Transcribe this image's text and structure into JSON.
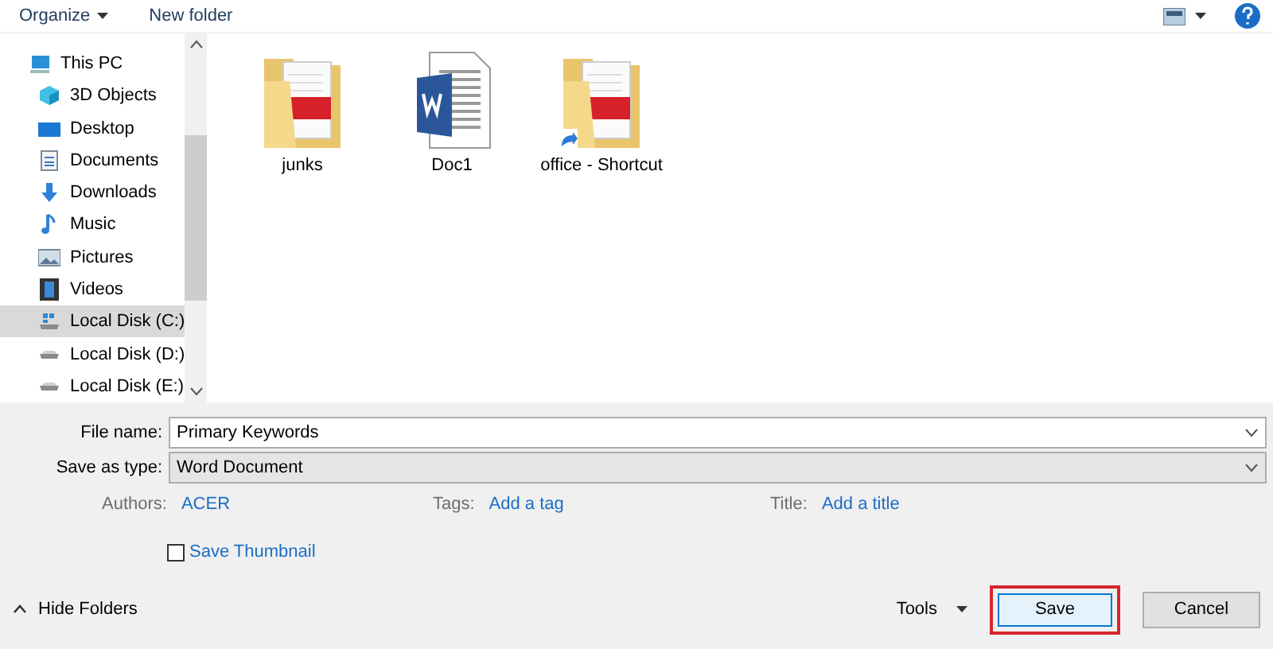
{
  "toolbar": {
    "buttons": [
      {
        "label": "Organize",
        "dropdown": true
      },
      {
        "label": "New folder",
        "dropdown": false
      }
    ]
  },
  "sidebar": {
    "items": [
      {
        "label": "This PC",
        "kind": "pc",
        "selected": false,
        "children": [
          {
            "label": "3D Objects",
            "kind": "cube",
            "selected": false
          },
          {
            "label": "Desktop",
            "kind": "desktop",
            "selected": false
          },
          {
            "label": "Documents",
            "kind": "documents",
            "selected": false
          },
          {
            "label": "Downloads",
            "kind": "downloads",
            "selected": false
          },
          {
            "label": "Music",
            "kind": "music",
            "selected": false
          },
          {
            "label": "Pictures",
            "kind": "pictures",
            "selected": false
          },
          {
            "label": "Videos",
            "kind": "videos",
            "selected": false
          },
          {
            "label": "Local Disk (C:)",
            "kind": "system-drive",
            "selected": true
          },
          {
            "label": "Local Disk (D:)",
            "kind": "drive",
            "selected": false
          },
          {
            "label": "Local Disk (E:)",
            "kind": "drive",
            "selected": false
          }
        ]
      }
    ]
  },
  "files": [
    {
      "name": "junks",
      "kind": "folder",
      "shortcut": false
    },
    {
      "name": "Doc1",
      "kind": "word",
      "shortcut": false
    },
    {
      "name": "office - Shortcut",
      "kind": "folder",
      "shortcut": true
    }
  ],
  "form": {
    "file_name": {
      "label": "File name:",
      "value": "Primary Keywords"
    },
    "save_as_type": {
      "label": "Save as type:",
      "value": "Word Document"
    },
    "meta": [
      {
        "label": "Authors:",
        "value": "ACER"
      },
      {
        "label": "Tags:",
        "value": "Add a tag"
      },
      {
        "label": "Title:",
        "value": "Add a title"
      }
    ],
    "save_thumbnail": {
      "label": "Save Thumbnail",
      "checked": false
    }
  },
  "footer": {
    "hide_folders": "Hide Folders",
    "tools": "Tools",
    "buttons": [
      {
        "label": "Save",
        "default": true,
        "highlighted": true
      },
      {
        "label": "Cancel",
        "default": false,
        "highlighted": false
      }
    ]
  }
}
